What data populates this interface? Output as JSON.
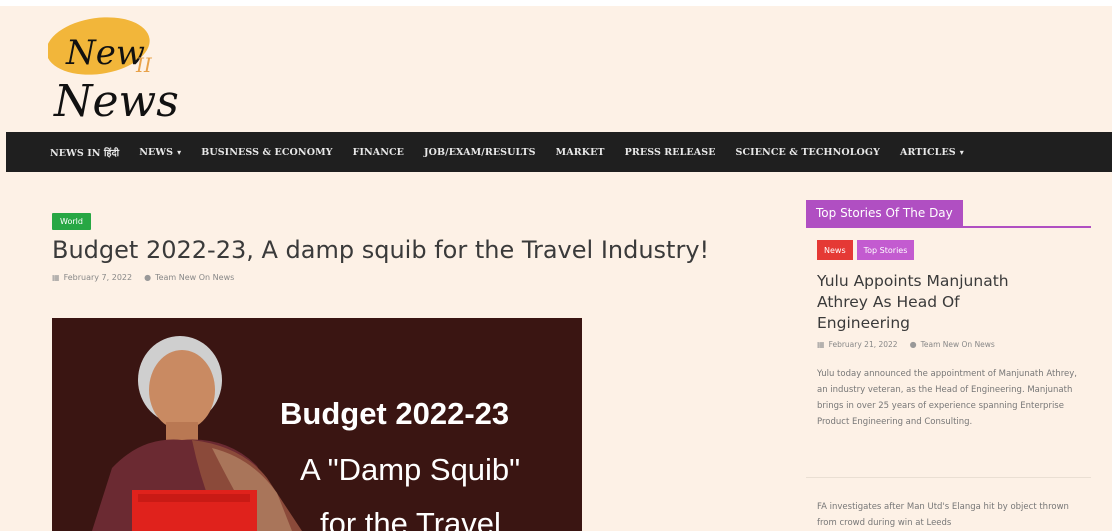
{
  "brand": {
    "logo_word1": "New",
    "logo_word2": "News",
    "logo_accent": "II",
    "colors": {
      "logo_oval": "#f2b63a",
      "logo_accent": "#e8a24a",
      "logo_text": "#111111"
    }
  },
  "nav": {
    "items": [
      {
        "label": "NEWS IN हिंदी",
        "has_dropdown": false
      },
      {
        "label": "NEWS",
        "has_dropdown": true
      },
      {
        "label": "BUSINESS & ECONOMY",
        "has_dropdown": false
      },
      {
        "label": "FINANCE",
        "has_dropdown": false
      },
      {
        "label": "JOB/EXAM/RESULTS",
        "has_dropdown": false
      },
      {
        "label": "MARKET",
        "has_dropdown": false
      },
      {
        "label": "PRESS RELEASE",
        "has_dropdown": false
      },
      {
        "label": "SCIENCE & TECHNOLOGY",
        "has_dropdown": false
      },
      {
        "label": "ARTICLES",
        "has_dropdown": true
      }
    ],
    "dropdown_glyph": "▾",
    "background": "#1f1f1f"
  },
  "article": {
    "category": "World",
    "title": "Budget 2022-23, A damp squib for the Travel Industry!",
    "date": "February 7, 2022",
    "author": "Team New On News",
    "date_icon": "calendar-icon",
    "author_icon": "user-icon",
    "featured_image": {
      "line1": "Budget 2022-23",
      "line2": "A \"Damp Squib\"",
      "line3": "for the Travel",
      "background": "#3a1512"
    }
  },
  "sidebar": {
    "heading": "Top Stories Of The Day",
    "heading_color": "#b04fc2",
    "badges": [
      "News",
      "Top Stories"
    ],
    "story": {
      "title": "Yulu Appoints Manjunath Athrey As Head Of Engineering",
      "date": "February 21, 2022",
      "author": "Team New On News",
      "excerpt": "Yulu today announced the appointment of Manjunath Athrey, an industry veteran, as the Head of Engineering. Manjunath brings in over 25 years of experience spanning Enterprise Product Engineering and Consulting."
    },
    "next_excerpt": "FA investigates after Man Utd's Elanga hit by object thrown from crowd during win at Leeds"
  }
}
